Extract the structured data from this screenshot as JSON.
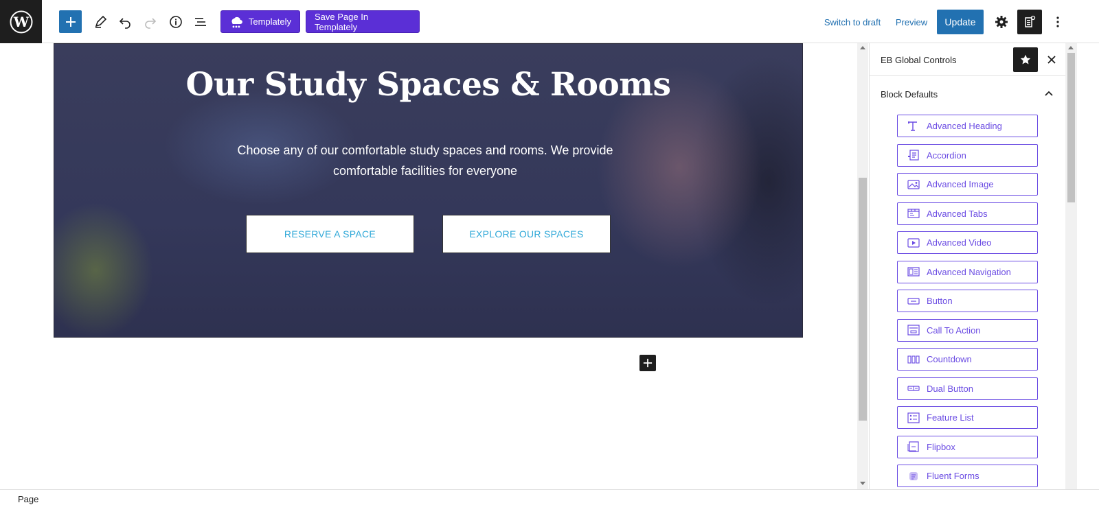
{
  "toolbar": {
    "templately_label": "Templately",
    "save_templately_label": "Save Page In Templately",
    "switch_to_draft_label": "Switch to draft",
    "preview_label": "Preview",
    "update_label": "Update",
    "icons": [
      "wordpress-icon",
      "plus-icon",
      "pencil-icon",
      "undo-icon",
      "redo-icon",
      "info-icon",
      "list-view-icon",
      "templately-icon",
      "settings-gear-icon",
      "essential-blocks-icon",
      "more-vertical-icon"
    ]
  },
  "hero": {
    "title": "Our Study Spaces & Rooms",
    "subtitle": "Choose any of our comfortable study spaces and rooms. We provide comfortable facilities for everyone",
    "button_primary": "RESERVE A SPACE",
    "button_secondary": "EXPLORE OUR SPACES",
    "button_text_color": "#2fa8d8"
  },
  "sidebar": {
    "title": "EB Global Controls",
    "panel_title": "Block Defaults",
    "accent_color": "#6a4be3",
    "blocks": [
      {
        "label": "Advanced Heading",
        "icon": "heading-block-icon"
      },
      {
        "label": "Accordion",
        "icon": "accordion-block-icon"
      },
      {
        "label": "Advanced Image",
        "icon": "image-block-icon"
      },
      {
        "label": "Advanced Tabs",
        "icon": "tabs-block-icon"
      },
      {
        "label": "Advanced Video",
        "icon": "video-block-icon"
      },
      {
        "label": "Advanced Navigation",
        "icon": "navigation-block-icon"
      },
      {
        "label": "Button",
        "icon": "button-block-icon"
      },
      {
        "label": "Call To Action",
        "icon": "cta-block-icon"
      },
      {
        "label": "Countdown",
        "icon": "countdown-block-icon"
      },
      {
        "label": "Dual Button",
        "icon": "dual-button-block-icon"
      },
      {
        "label": "Feature List",
        "icon": "feature-list-block-icon"
      },
      {
        "label": "Flipbox",
        "icon": "flipbox-block-icon"
      },
      {
        "label": "Fluent Forms",
        "icon": "fluent-forms-block-icon"
      }
    ]
  },
  "footer": {
    "breadcrumb": "Page"
  },
  "colors": {
    "wp_blue": "#2271b1",
    "templately_purple": "#5b2fd6",
    "dark": "#1e1e1e"
  }
}
